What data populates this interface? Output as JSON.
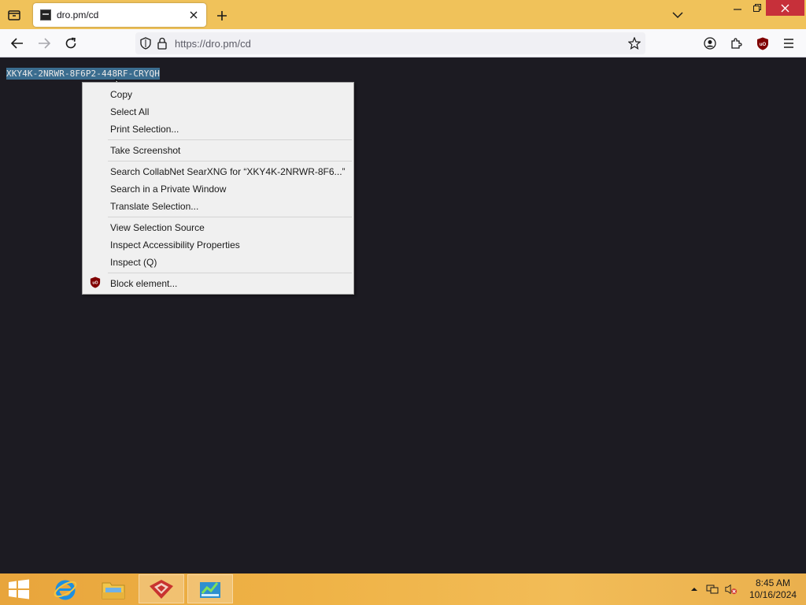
{
  "browser": {
    "tab_title": "dro.pm/cd",
    "url_scheme": "https://",
    "url_host": "dro.pm/cd"
  },
  "page": {
    "selected_text": "XKY4K-2NRWR-8F6P2-448RF-CRYQH"
  },
  "context_menu": {
    "items": [
      {
        "label": "Copy"
      },
      {
        "label": "Select All"
      },
      {
        "label": "Print Selection..."
      },
      {
        "label": "Take Screenshot"
      },
      {
        "label": "Search CollabNet SearXNG for “XKY4K-2NRWR-8F6...”"
      },
      {
        "label": "Search in a Private Window"
      },
      {
        "label": "Translate Selection..."
      },
      {
        "label": "View Selection Source"
      },
      {
        "label": "Inspect Accessibility Properties"
      },
      {
        "label": "Inspect (Q)"
      },
      {
        "label": "Block element..."
      }
    ]
  },
  "taskbar": {
    "time": "8:45 AM",
    "date": "10/16/2024"
  },
  "colors": {
    "titlebar": "#f0c25a",
    "selection": "#3b6d8f",
    "page_bg": "#1c1b22",
    "ublock_red": "#800000"
  },
  "icons": {
    "start": "windows-logo-icon",
    "ie": "internet-explorer-icon",
    "explorer": "file-explorer-icon",
    "app1": "red-app-icon",
    "app2": "chart-app-icon"
  }
}
